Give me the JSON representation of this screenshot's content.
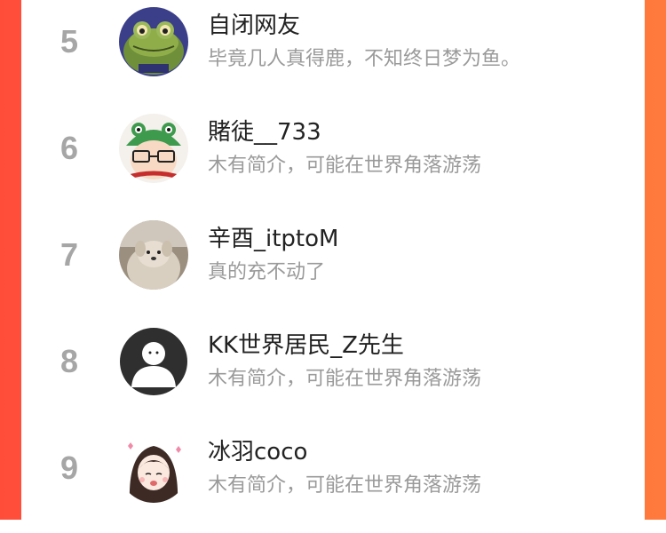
{
  "theme": {
    "accent_left": "#ff4d3a",
    "accent_right": "#ff7a3c",
    "rank_color": "#a6a6a6",
    "name_color": "#222222",
    "bio_color": "#9a9a9a"
  },
  "ranking": {
    "items": [
      {
        "rank": "5",
        "name": "自闭网友",
        "bio": "毕竟几人真得鹿，不知终日梦为鱼。",
        "avatar_icon": "frog-avatar-icon"
      },
      {
        "rank": "6",
        "name": "賭徒__733",
        "bio": "木有简介，可能在世界角落游荡",
        "avatar_icon": "cat-frog-hat-avatar-icon"
      },
      {
        "rank": "7",
        "name": "辛酉_itptoM",
        "bio": "真的充不动了",
        "avatar_icon": "dog-avatar-icon"
      },
      {
        "rank": "8",
        "name": "KK世界居民_Z先生",
        "bio": "木有简介，可能在世界角落游荡",
        "avatar_icon": "default-avatar-icon"
      },
      {
        "rank": "9",
        "name": "冰羽coco",
        "bio": "木有简介，可能在世界角落游荡",
        "avatar_icon": "anime-girl-avatar-icon"
      }
    ]
  }
}
